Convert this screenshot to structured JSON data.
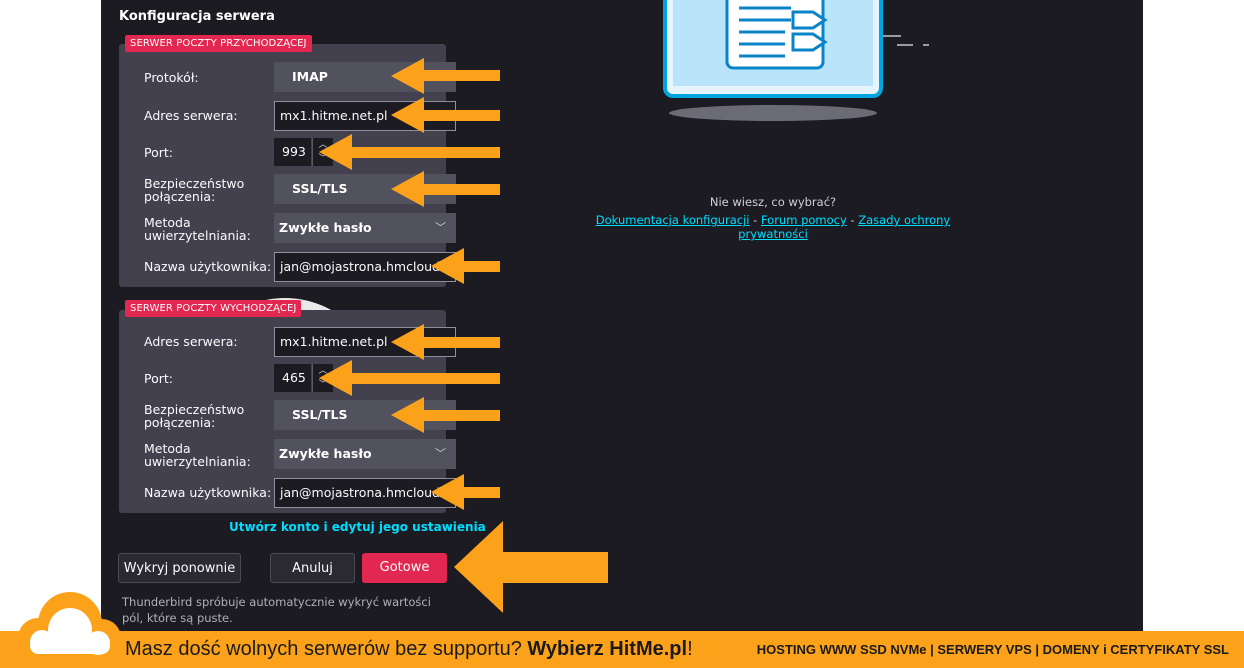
{
  "config": {
    "title": "Konfiguracja serwera",
    "incoming": {
      "tag": "SERWER POCZTY PRZYCHODZĄCEJ",
      "protocol_label": "Protokół:",
      "protocol_value": "IMAP",
      "server_label": "Adres serwera:",
      "server_value": "mx1.hitme.net.pl",
      "port_label": "Port:",
      "port_value": "993",
      "security_label_1": "Bezpieczeństwo",
      "security_label_2": "połączenia:",
      "security_value": "SSL/TLS",
      "auth_label_1": "Metoda",
      "auth_label_2": "uwierzytelniania:",
      "auth_value": "Zwykłe hasło",
      "username_label": "Nazwa użytkownika:",
      "username_value": "jan@mojastrona.hmcloud.pl"
    },
    "outgoing": {
      "tag": "SERWER POCZTY WYCHODZĄCEJ",
      "server_label": "Adres serwera:",
      "server_value": "mx1.hitme.net.pl",
      "port_label": "Port:",
      "port_value": "465",
      "security_label_1": "Bezpieczeństwo",
      "security_label_2": "połączenia:",
      "security_value": "SSL/TLS",
      "auth_label_1": "Metoda",
      "auth_label_2": "uwierzytelniania:",
      "auth_value": "Zwykłe hasło",
      "username_label": "Nazwa użytkownika:",
      "username_value": "jan@mojastrona.hmcloud.pl"
    },
    "create_link": "Utwórz konto i edytuj jego ustawienia",
    "buttons": {
      "redetect": "Wykryj ponownie",
      "cancel": "Anuluj",
      "done": "Gotowe"
    },
    "hint": "Thunderbird spróbuje automatycznie wykryć wartości pól, które są puste."
  },
  "help": {
    "question": "Nie wiesz, co wybrać?",
    "link_docs": "Dokumentacja konfiguracji",
    "sep": " - ",
    "link_forum": "Forum pomocy",
    "link_privacy": "Zasady ochrony prywatności"
  },
  "banner": {
    "text_prefix": "Masz dość wolnych serwerów bez supportu? ",
    "text_brand": "Wybierz HitMe.pl",
    "text_suffix": "!",
    "right_text": "HOSTING WWW SSD NVMe | SERWERY VPS | DOMENY i CERTYFIKATY SSL"
  },
  "colors": {
    "accent_red": "#e22850",
    "link_cyan": "#00ddff",
    "arrow_orange": "#fca21a",
    "app_bg": "#1c1b22",
    "group_bg": "#42414d"
  },
  "icons": {
    "chevron": "chevron-down-icon",
    "spin_up": "chevron-up-icon",
    "spin_down": "chevron-down-icon",
    "illustration": "document-illustration",
    "logo": "cloud-logo-icon"
  }
}
